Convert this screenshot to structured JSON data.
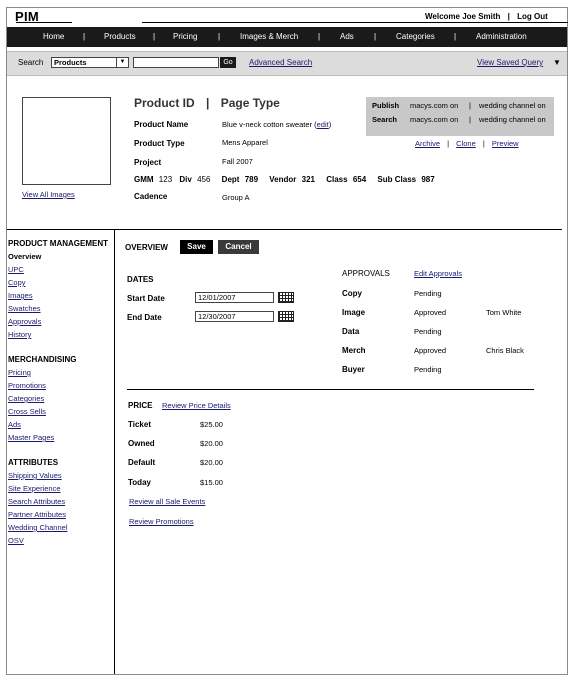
{
  "app": {
    "title": "PIM",
    "welcome": "Welcome Joe Smith",
    "logout": "Log Out",
    "sep": "|"
  },
  "nav": {
    "items": [
      "Home",
      "Products",
      "Pricing",
      "Images & Merch",
      "Ads",
      "Categories",
      "Administration"
    ]
  },
  "search": {
    "label": "Search",
    "scope": "Products",
    "query": "",
    "go": "Go",
    "advanced": "Advanced Search",
    "saved": "View Saved Query"
  },
  "product": {
    "title_id": "Product ID",
    "title_sep": "|",
    "title_type": "Page Type",
    "view_all_images": "View All Images",
    "fields": {
      "name_label": "Product Name",
      "name_value": "Blue v-neck cotton sweater",
      "edit": "edit",
      "type_label": "Product Type",
      "type_value": "Mens Apparel",
      "project_label": "Project",
      "project_value": "Fall 2007",
      "gmm_label": "GMM",
      "gmm_value": "123",
      "div_label": "Div",
      "div_value": "456",
      "dept_label": "Dept",
      "dept_value": "789",
      "vendor_label": "Vendor",
      "vendor_value": "321",
      "class_label": "Class",
      "class_value": "654",
      "subclass_label": "Sub Class",
      "subclass_value": "987",
      "cadence_label": "Cadence",
      "cadence_value": "Group A"
    },
    "publish": {
      "publish_label": "Publish",
      "search_label": "Search",
      "site1": "macys.com on",
      "site2": "wedding channel on",
      "sep": "|"
    },
    "actions": {
      "archive": "Archive",
      "clone": "Clone",
      "preview": "Preview",
      "sep": "|"
    }
  },
  "sidebar": {
    "sections": [
      {
        "heading": "PRODUCT MANAGEMENT",
        "current": "Overview",
        "links": [
          "UPC",
          "Copy",
          "Images",
          "Swatches",
          "Approvals",
          "History"
        ]
      },
      {
        "heading": "MERCHANDISING",
        "links": [
          "Pricing",
          "Promotions",
          "Categories",
          "Cross Sells",
          "Ads",
          "Master Pages"
        ]
      },
      {
        "heading": "ATTRIBUTES",
        "links": [
          "Shipping Values",
          "Site Experience",
          "Search Attributes",
          "Partner Attributes",
          "Wedding Channel",
          "OSV"
        ]
      }
    ]
  },
  "overview": {
    "heading": "OVERVIEW",
    "save": "Save",
    "cancel": "Cancel",
    "dates": {
      "heading": "DATES",
      "start_label": "Start Date",
      "start_value": "12/01/2007",
      "end_label": "End Date",
      "end_value": "12/30/2007"
    },
    "approvals": {
      "heading": "APPROVALS",
      "edit": "Edit Approvals",
      "rows": [
        {
          "label": "Copy",
          "status": "Pending",
          "person": ""
        },
        {
          "label": "Image",
          "status": "Approved",
          "person": "Tom White"
        },
        {
          "label": "Data",
          "status": "Pending",
          "person": ""
        },
        {
          "label": "Merch",
          "status": "Approved",
          "person": "Chris Black"
        },
        {
          "label": "Buyer",
          "status": "Pending",
          "person": ""
        }
      ]
    },
    "price": {
      "heading": "PRICE",
      "review_details": "Review Price Details",
      "rows": [
        {
          "label": "Ticket",
          "value": "$25.00"
        },
        {
          "label": "Owned",
          "value": "$20.00"
        },
        {
          "label": "Default",
          "value": "$20.00"
        },
        {
          "label": "Today",
          "value": "$15.00"
        }
      ],
      "review_sale_events": "Review all Sale Events",
      "review_promotions": "Review Promotions"
    }
  }
}
